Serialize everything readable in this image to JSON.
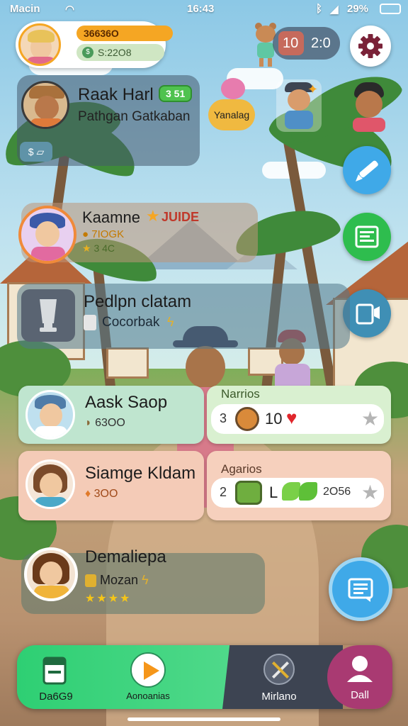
{
  "status_bar": {
    "carrier": "Macin",
    "time": "16:43",
    "battery": "29%"
  },
  "profile": {
    "name": "36636O",
    "coins": "S:22O8"
  },
  "timer": {
    "left": "10",
    "right": "2:0"
  },
  "player_card": {
    "name": "Raak Harl",
    "badge": "3 51",
    "subtitle": "Pathgan Gatkaban",
    "tag": "Yanalag"
  },
  "featured": {
    "name": "Kaamne",
    "badge": "JUIDE",
    "line1": "7IOGK",
    "line2": "3 4C"
  },
  "item_panel": {
    "title": "Pedlpn clatam",
    "subtitle": "Cocorbak"
  },
  "cards": [
    {
      "name": "Aask Saop",
      "stat": "63OO",
      "right_title": "Narrios",
      "right_number_left": "3",
      "right_number": "10"
    },
    {
      "name": "Siamge Kldam",
      "stat": "3OO",
      "right_title": "Agarios",
      "right_number_left": "2",
      "right_letter": "L",
      "right_number": "2O56"
    }
  ],
  "bottom_player": {
    "name": "Demaliepa",
    "stat": "Mozan",
    "stars": "★★★★"
  },
  "nav": {
    "item1": "Da6G9",
    "item2": "Aonoanias",
    "item3": "Mirlano",
    "item4": "Dall"
  },
  "colors": {
    "accent_green": "#2ecf73",
    "orange": "#f5a623",
    "purple": "#a93a72",
    "blue_button": "#3fa9e8"
  }
}
